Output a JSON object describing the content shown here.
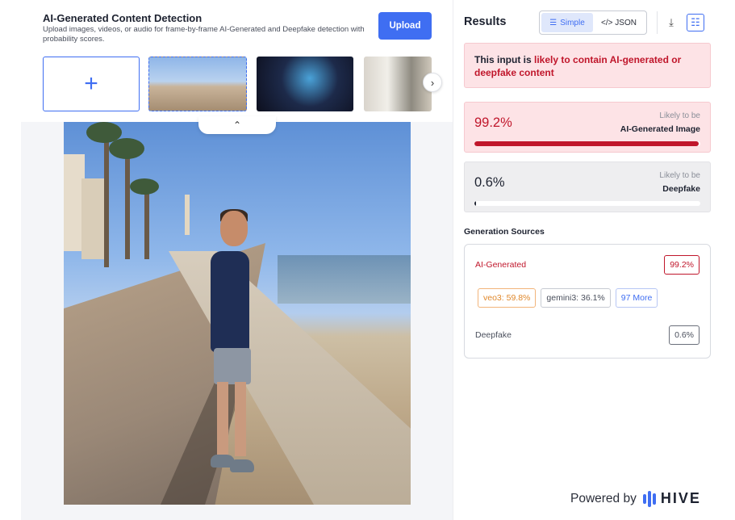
{
  "header": {
    "title": "AI-Generated Content Detection",
    "description": "Upload images, videos, or audio for frame-by-frame AI-Generated and Deepfake detection with probability scores.",
    "upload_label": "Upload"
  },
  "thumbnails": {
    "add_symbol": "+",
    "next_symbol": "›",
    "collapse_symbol": "⌃"
  },
  "preview": {
    "watermark": ""
  },
  "results": {
    "title": "Results",
    "view_toggle": {
      "simple_label": "Simple",
      "json_label": "</> JSON",
      "selected": "Simple"
    },
    "verdict": {
      "prefix": "This input is ",
      "highlight": "likely to contain AI-generated or deepfake content"
    },
    "ai_score": {
      "value": "99.2%",
      "fraction": 0.992,
      "caption_top": "Likely to be",
      "caption_bottom": "AI-Generated Image"
    },
    "deepfake_score": {
      "value": "0.6%",
      "fraction": 0.006,
      "caption_top": "Likely to be",
      "caption_bottom": "Deepfake"
    },
    "generation_sources": {
      "title": "Generation Sources",
      "ai_label": "AI-Generated",
      "ai_pct": "99.2%",
      "chips": [
        "veo3: 59.8%",
        "gemini3: 36.1%",
        "97 More"
      ],
      "deepfake_label": "Deepfake",
      "deepfake_pct": "0.6%"
    }
  },
  "footer": {
    "powered_by": "Powered by",
    "brand": "HIVE"
  },
  "colors": {
    "accent": "#3f6ef2",
    "alert": "#c0162b",
    "alert_bg": "#fde3e6"
  }
}
